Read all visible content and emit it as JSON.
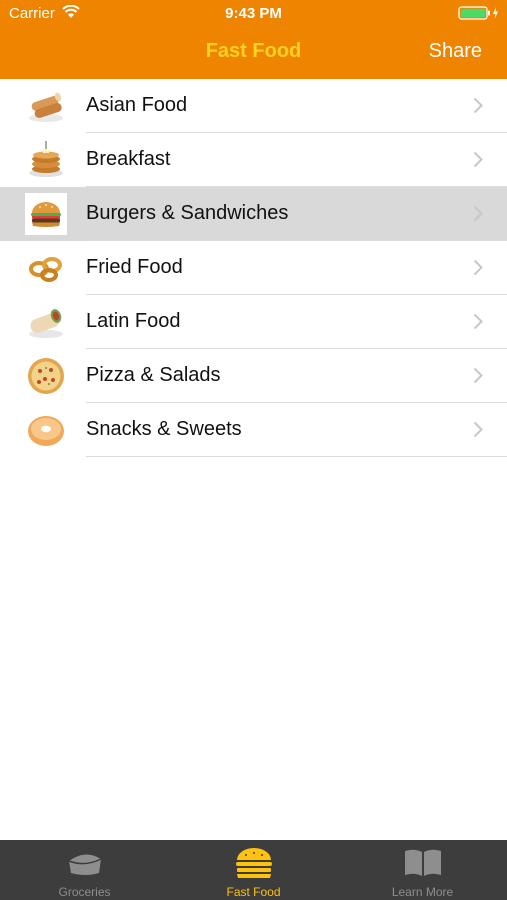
{
  "status_bar": {
    "carrier": "Carrier",
    "time": "9:43 PM"
  },
  "nav": {
    "title": "Fast Food",
    "share_label": "Share"
  },
  "categories": [
    {
      "label": "Asian Food",
      "icon": "spring-roll-icon",
      "selected": false
    },
    {
      "label": "Breakfast",
      "icon": "pancakes-icon",
      "selected": false
    },
    {
      "label": "Burgers & Sandwiches",
      "icon": "burger-icon",
      "selected": true
    },
    {
      "label": "Fried Food",
      "icon": "onion-rings-icon",
      "selected": false
    },
    {
      "label": "Latin Food",
      "icon": "burrito-icon",
      "selected": false
    },
    {
      "label": "Pizza & Salads",
      "icon": "pizza-icon",
      "selected": false
    },
    {
      "label": "Snacks & Sweets",
      "icon": "donut-icon",
      "selected": false
    }
  ],
  "tabs": [
    {
      "label": "Groceries",
      "icon": "groceries-icon",
      "active": false
    },
    {
      "label": "Fast Food",
      "icon": "burger-tab-icon",
      "active": true
    },
    {
      "label": "Learn More",
      "icon": "book-icon",
      "active": false
    }
  ],
  "colors": {
    "header": "#ef8400",
    "title": "#ffd21f",
    "selected_row": "#d9d9d9",
    "tab_bar": "#3d3d3d",
    "tab_active": "#ffc20e",
    "tab_inactive": "#8e8e8e"
  }
}
